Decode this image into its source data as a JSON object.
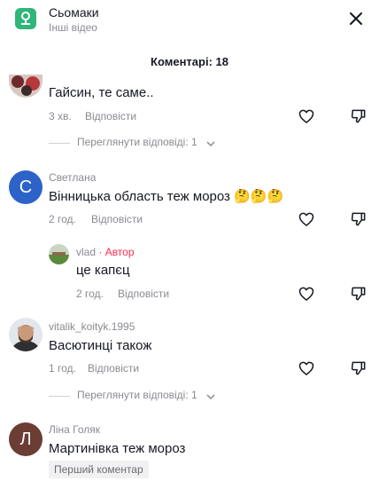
{
  "header": {
    "app_name": "Сьомаки",
    "subtitle": "Інші відео"
  },
  "comments_title": "Коментарі: 18",
  "colors": {
    "author_accent": "#fe2c55",
    "app_icon": "#2fb67a"
  },
  "comments": [
    {
      "text": "Гайсин, те саме..",
      "time": "3 хв.",
      "reply_label": "Відповісти",
      "view_replies": "Переглянути відповіді: 1"
    },
    {
      "username": "Светлана",
      "avatar_letter": "С",
      "text": "Вінницька область теж мороз 🤔🤔🤔",
      "time": "2 год.",
      "reply_label": "Відповісти",
      "reply": {
        "username": "vlad",
        "author_separator": " · ",
        "author_tag": "Автор",
        "text": "це капєц",
        "time": "2 год.",
        "reply_label": "Відповісти"
      }
    },
    {
      "username": "vitalik_koityk.1995",
      "text": "Васютинці також",
      "time": "1 год.",
      "reply_label": "Відповісти",
      "view_replies": "Переглянути відповіді: 1"
    },
    {
      "username": "Ліна Голяк",
      "avatar_letter": "Л",
      "text": "Мартинівка теж мороз",
      "badge": "Перший коментар"
    }
  ]
}
